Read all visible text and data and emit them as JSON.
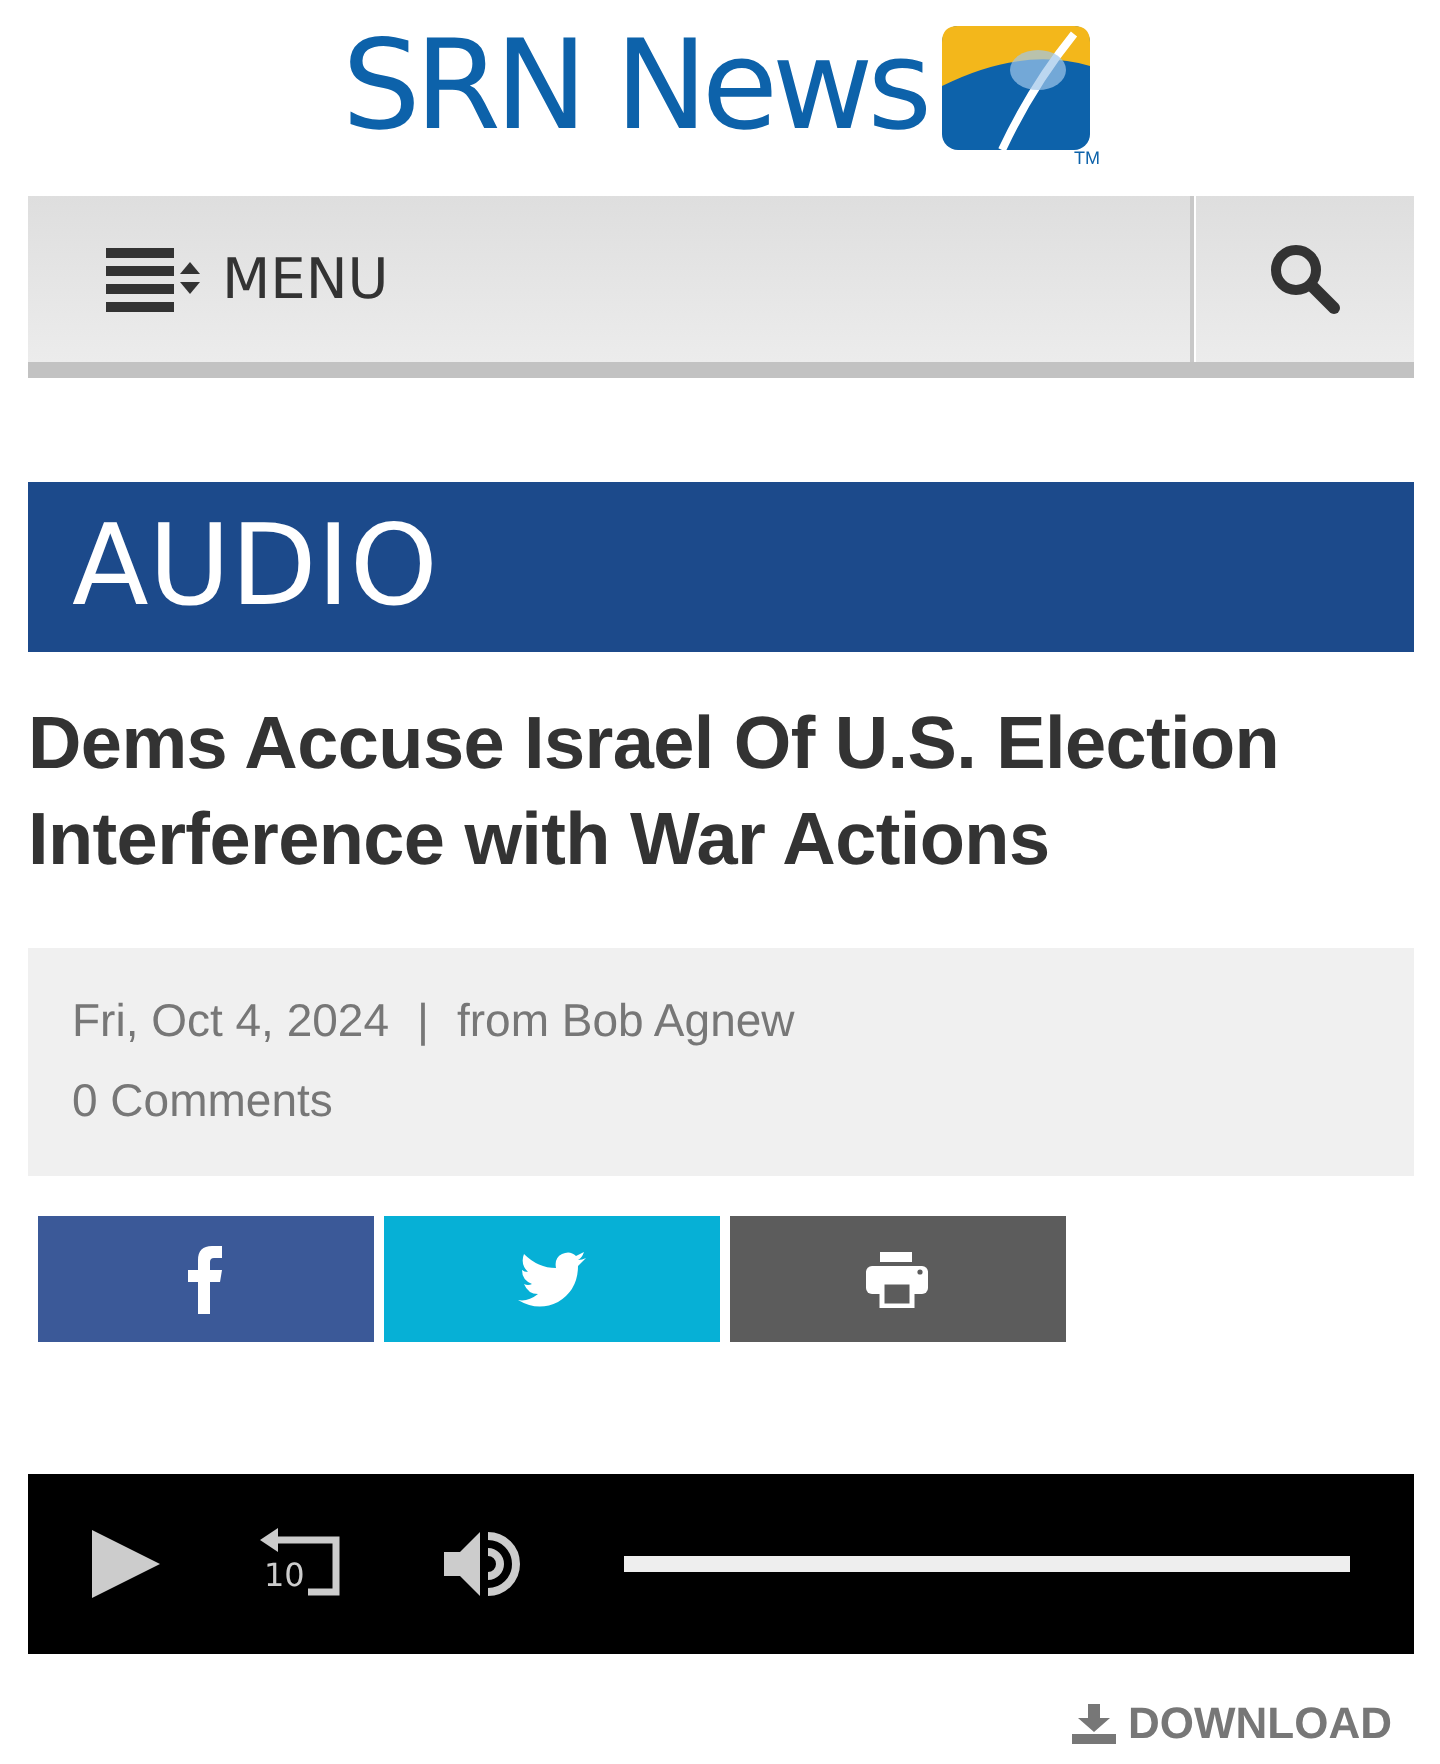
{
  "logo": {
    "text": "SRN News",
    "trademark": "TM"
  },
  "nav": {
    "menu_label": "MENU"
  },
  "section_banner": "AUDIO",
  "article": {
    "headline": "Dems Accuse Israel Of U.S. Election Interference with War Actions",
    "date": "Fri, Oct 4, 2024",
    "separator": "|",
    "byline": "from Bob Agnew",
    "comments": "0 Comments"
  },
  "share_buttons": [
    {
      "kind": "facebook",
      "color": "#3b5998"
    },
    {
      "kind": "twitter",
      "color": "#06b0d6"
    },
    {
      "kind": "print",
      "color": "#5c5c5c"
    }
  ],
  "player": {
    "rewind_label": "10"
  },
  "download_label": "DOWNLOAD"
}
